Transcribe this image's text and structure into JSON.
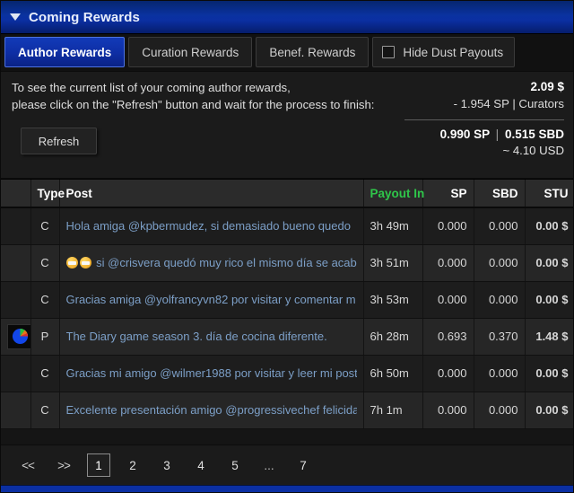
{
  "window": {
    "title": "Coming Rewards",
    "collapse_icon": "chevron-down-icon",
    "titlebar_color": "#0b2fa2"
  },
  "tabs": [
    {
      "label": "Author Rewards",
      "active": true
    },
    {
      "label": "Curation Rewards",
      "active": false
    },
    {
      "label": "Benef. Rewards",
      "active": false
    }
  ],
  "hide_dust": {
    "label": "Hide Dust Payouts",
    "checked": false
  },
  "summary": {
    "line1": "To see the current list of your coming author rewards,",
    "line2": "please click on the \"Refresh\" button and wait for the process to finish:",
    "refresh_label": "Refresh",
    "total_usd": "2.09 $",
    "curators_amount": "- 1.954 SP",
    "curators_sep": "|",
    "curators_label": "Curators",
    "sp_value": "0.990 SP",
    "pair_sep": "|",
    "sbd_value": "0.515 SBD",
    "approx_usd": "~ 4.10 USD"
  },
  "table": {
    "columns": [
      {
        "key": "icon",
        "label": "",
        "align": "left"
      },
      {
        "key": "type",
        "label": "Type",
        "align": "left"
      },
      {
        "key": "post",
        "label": "Post",
        "align": "left"
      },
      {
        "key": "payout",
        "label": "Payout In",
        "align": "right",
        "sorted": true
      },
      {
        "key": "sp",
        "label": "SP",
        "align": "right"
      },
      {
        "key": "sbd",
        "label": "SBD",
        "align": "right"
      },
      {
        "key": "stu",
        "label": "STU",
        "align": "right"
      }
    ],
    "rows": [
      {
        "icon": "",
        "type": "C",
        "post": "Hola amiga @kpbermudez, si demasiado bueno quedo",
        "payout": "3h 49m",
        "sp": "0.000",
        "sbd": "0.000",
        "stu": "0.00 $"
      },
      {
        "icon": "",
        "type": "C",
        "emoji_count": 2,
        "post": "si @crisvera quedó muy rico el mismo día se acab",
        "payout": "3h 51m",
        "sp": "0.000",
        "sbd": "0.000",
        "stu": "0.00 $"
      },
      {
        "icon": "",
        "type": "C",
        "post": "Gracias amiga @yolfrancyvn82 por visitar y comentar m",
        "payout": "3h 53m",
        "sp": "0.000",
        "sbd": "0.000",
        "stu": "0.00 $"
      },
      {
        "icon": "pie-chart-icon",
        "type": "P",
        "post": "The Diary game season 3. día de cocina diferente.",
        "payout": "6h 28m",
        "sp": "0.693",
        "sbd": "0.370",
        "stu": "1.48 $"
      },
      {
        "icon": "",
        "type": "C",
        "post": "Gracias mi amigo @wilmer1988 por visitar y leer mi post",
        "payout": "6h 50m",
        "sp": "0.000",
        "sbd": "0.000",
        "stu": "0.00 $"
      },
      {
        "icon": "",
        "type": "C",
        "post": "Excelente presentación amigo @progressivechef felicida",
        "payout": "7h 1m",
        "sp": "0.000",
        "sbd": "0.000",
        "stu": "0.00 $"
      }
    ]
  },
  "pager": {
    "first_label": "<<",
    "prev_label": ">>",
    "pages": [
      "1",
      "2",
      "3",
      "4",
      "5",
      "...",
      "7"
    ],
    "current": "1"
  },
  "colors": {
    "accent_blue": "#0b2fa2",
    "sorted_green": "#2fc64a",
    "link_blue": "#7c9fc7"
  }
}
